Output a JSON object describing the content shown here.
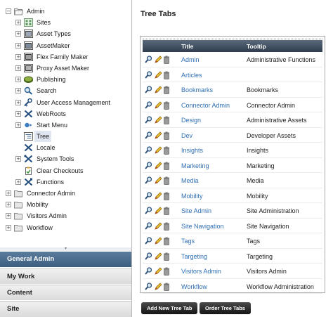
{
  "tree": [
    {
      "label": "Admin",
      "icon": "folder-open-icon",
      "depth": 0,
      "expander": "−",
      "selected": false
    },
    {
      "label": "Sites",
      "icon": "sites-icon",
      "depth": 1,
      "expander": "+",
      "selected": false
    },
    {
      "label": "Asset Types",
      "icon": "asset-types-icon",
      "depth": 1,
      "expander": "+",
      "selected": false
    },
    {
      "label": "AssetMaker",
      "icon": "asset-maker-icon",
      "depth": 1,
      "expander": "+",
      "selected": false
    },
    {
      "label": "Flex Family Maker",
      "icon": "flex-family-icon",
      "depth": 1,
      "expander": "+",
      "selected": false
    },
    {
      "label": "Proxy Asset Maker",
      "icon": "proxy-asset-icon",
      "depth": 1,
      "expander": "+",
      "selected": false
    },
    {
      "label": "Publishing",
      "icon": "publishing-icon",
      "depth": 1,
      "expander": "+",
      "selected": false
    },
    {
      "label": "Search",
      "icon": "search-icon",
      "depth": 1,
      "expander": "+",
      "selected": false
    },
    {
      "label": "User Access Management",
      "icon": "user-access-icon",
      "depth": 1,
      "expander": "+",
      "selected": false
    },
    {
      "label": "WebRoots",
      "icon": "webroots-icon",
      "depth": 1,
      "expander": "+",
      "selected": false
    },
    {
      "label": "Start Menu",
      "icon": "start-menu-icon",
      "depth": 1,
      "expander": "+",
      "selected": false
    },
    {
      "label": "Tree",
      "icon": "tree-icon",
      "depth": 1,
      "expander": "",
      "selected": true
    },
    {
      "label": "Locale",
      "icon": "locale-icon",
      "depth": 1,
      "expander": "",
      "selected": false
    },
    {
      "label": "System Tools",
      "icon": "system-tools-icon",
      "depth": 1,
      "expander": "+",
      "selected": false
    },
    {
      "label": "Clear Checkouts",
      "icon": "clear-checkouts-icon",
      "depth": 1,
      "expander": "",
      "selected": false
    },
    {
      "label": "Functions",
      "icon": "functions-icon",
      "depth": 1,
      "expander": "+",
      "selected": false
    },
    {
      "label": "Connector Admin",
      "icon": "folder-icon",
      "depth": 0,
      "expander": "+",
      "selected": false
    },
    {
      "label": "Mobility",
      "icon": "folder-icon",
      "depth": 0,
      "expander": "+",
      "selected": false
    },
    {
      "label": "Visitors Admin",
      "icon": "folder-icon",
      "depth": 0,
      "expander": "+",
      "selected": false
    },
    {
      "label": "Workflow",
      "icon": "folder-icon",
      "depth": 0,
      "expander": "+",
      "selected": false
    }
  ],
  "grip_glyph": "▾",
  "accordion": {
    "general_admin": "General Admin",
    "my_work": "My Work",
    "content": "Content",
    "site": "Site"
  },
  "page_title": "Tree Tabs",
  "table": {
    "headers": {
      "title": "Title",
      "tooltip": "Tooltip"
    },
    "action_icons": [
      "inspect-icon",
      "edit-pencil-icon",
      "delete-trash-icon"
    ],
    "rows": [
      {
        "title": "Admin",
        "tooltip": "Administrative Functions"
      },
      {
        "title": "Articles",
        "tooltip": ""
      },
      {
        "title": "Bookmarks",
        "tooltip": "Bookmarks"
      },
      {
        "title": "Connector Admin",
        "tooltip": "Connector Admin"
      },
      {
        "title": "Design",
        "tooltip": "Administrative Assets"
      },
      {
        "title": "Dev",
        "tooltip": "Developer Assets"
      },
      {
        "title": "Insights",
        "tooltip": "Insights"
      },
      {
        "title": "Marketing",
        "tooltip": "Marketing"
      },
      {
        "title": "Media",
        "tooltip": "Media"
      },
      {
        "title": "Mobility",
        "tooltip": "Mobility"
      },
      {
        "title": "Site Admin",
        "tooltip": "Site Administration"
      },
      {
        "title": "Site Navigation",
        "tooltip": "Site Navigation"
      },
      {
        "title": "Tags",
        "tooltip": "Tags"
      },
      {
        "title": "Targeting",
        "tooltip": "Targeting"
      },
      {
        "title": "Visitors Admin",
        "tooltip": "Visitors Admin"
      },
      {
        "title": "Workflow",
        "tooltip": "Workflow Administration"
      }
    ]
  },
  "buttons": {
    "add_new": "Add New Tree Tab",
    "order": "Order Tree Tabs"
  },
  "colors": {
    "link": "#2f6fb3",
    "header_dark": "#2f3d4e",
    "accordion_active": "#4a6b8c"
  }
}
